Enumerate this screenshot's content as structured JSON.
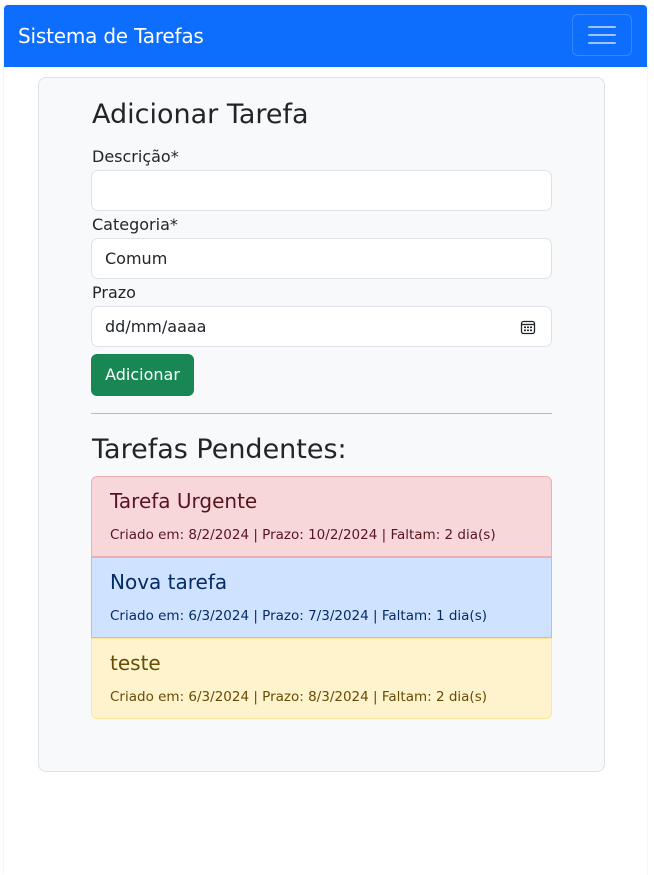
{
  "app": {
    "brand": "Sistema de Tarefas",
    "nav_color": "#0d6efd"
  },
  "form": {
    "title": "Adicionar Tarefa",
    "description_label": "Descrição*",
    "description_value": "",
    "category_label": "Categoria*",
    "category_value": "Comum",
    "deadline_label": "Prazo",
    "deadline_placeholder": "dd/mm/aaaa",
    "submit_label": "Adicionar"
  },
  "pending": {
    "title": "Tarefas Pendentes:",
    "tasks": [
      {
        "title": "Tarefa Urgente",
        "meta": "Criado em: 8/2/2024 | Prazo: 10/2/2024 | Faltam: 2 dia(s)",
        "bg": "#f8d7da",
        "border": "#f1aeb5",
        "text": "#58151c"
      },
      {
        "title": "Nova tarefa",
        "meta": "Criado em: 6/3/2024 | Prazo: 7/3/2024 | Faltam: 1 dia(s)",
        "bg": "#cfe2ff",
        "border": "#9ec5fe",
        "text": "#052c65"
      },
      {
        "title": "teste",
        "meta": "Criado em: 6/3/2024 | Prazo: 8/3/2024 | Faltam: 2 dia(s)",
        "bg": "#fff3cd",
        "border": "#ffe69c",
        "text": "#664d03"
      }
    ]
  },
  "icons": {
    "menu": "hamburger-menu-icon",
    "calendar": "calendar-icon"
  }
}
